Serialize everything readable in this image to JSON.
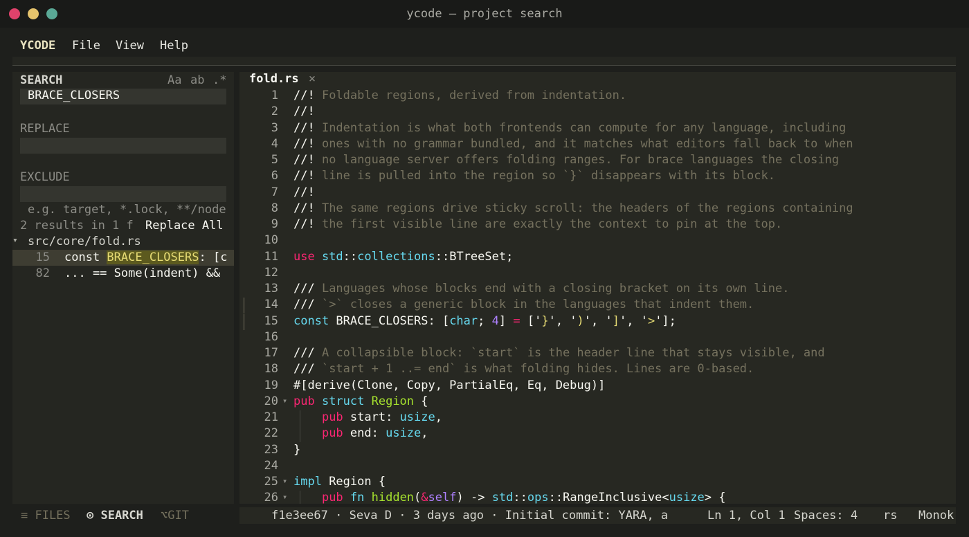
{
  "window": {
    "title": "ycode — project search",
    "traffic_lights": [
      "#e0426b",
      "#e5c36c",
      "#5aa996"
    ]
  },
  "menu": {
    "brand": "YCODE",
    "items": [
      "File",
      "View",
      "Help"
    ]
  },
  "sidebar": {
    "search_label": "SEARCH",
    "options": [
      "Aa",
      "ab",
      ".*"
    ],
    "search_value": "BRACE_CLOSERS",
    "replace_label": "REPLACE",
    "replace_value": "",
    "exclude_label": "EXCLUDE",
    "exclude_value": "",
    "exclude_placeholder": "e.g. target, *.lock, **/node",
    "results_summary": "2 results in 1 f",
    "replace_all_label": "Replace All",
    "file": {
      "chevron": "▾",
      "path": "src/core/fold.rs"
    },
    "results": [
      {
        "line": "15",
        "before": "const ",
        "match": "BRACE_CLOSERS",
        "after": ": [c"
      },
      {
        "line": "82",
        "before": "... == Some(indent) &&",
        "match": "",
        "after": ""
      }
    ]
  },
  "editor": {
    "tab_label": "fold.rs",
    "tab_close": "×",
    "lines": [
      {
        "n": "1",
        "tokens": [
          [
            "plain",
            "//! "
          ],
          [
            "comment",
            "Foldable regions, derived from indentation."
          ]
        ]
      },
      {
        "n": "2",
        "tokens": [
          [
            "plain",
            "//!"
          ]
        ]
      },
      {
        "n": "3",
        "tokens": [
          [
            "plain",
            "//! "
          ],
          [
            "comment",
            "Indentation is what both frontends can compute for any language, including"
          ]
        ]
      },
      {
        "n": "4",
        "tokens": [
          [
            "plain",
            "//! "
          ],
          [
            "comment",
            "ones with no grammar bundled, and it matches what editors fall back to when"
          ]
        ]
      },
      {
        "n": "5",
        "tokens": [
          [
            "plain",
            "//! "
          ],
          [
            "comment",
            "no language server offers folding ranges. For brace languages the closing"
          ]
        ]
      },
      {
        "n": "6",
        "tokens": [
          [
            "plain",
            "//! "
          ],
          [
            "comment",
            "line is pulled into the region so `}` disappears with its block."
          ]
        ]
      },
      {
        "n": "7",
        "tokens": [
          [
            "plain",
            "//!"
          ]
        ]
      },
      {
        "n": "8",
        "tokens": [
          [
            "plain",
            "//! "
          ],
          [
            "comment",
            "The same regions drive sticky scroll: the headers of the regions containing"
          ]
        ]
      },
      {
        "n": "9",
        "tokens": [
          [
            "plain",
            "//! "
          ],
          [
            "comment",
            "the first visible line are exactly the context to pin at the top."
          ]
        ]
      },
      {
        "n": "10",
        "tokens": []
      },
      {
        "n": "11",
        "tokens": [
          [
            "kw",
            "use "
          ],
          [
            "type",
            "std"
          ],
          [
            "plain",
            "::"
          ],
          [
            "type",
            "collections"
          ],
          [
            "plain",
            "::BTreeSet;"
          ]
        ]
      },
      {
        "n": "12",
        "tokens": []
      },
      {
        "n": "13",
        "tokens": [
          [
            "plain",
            "/// "
          ],
          [
            "comment",
            "Languages whose blocks end with a closing bracket on its own line."
          ]
        ]
      },
      {
        "n": "14",
        "tokens": [
          [
            "plain",
            "/// "
          ],
          [
            "comment",
            "`>` closes a generic block in the languages that indent them."
          ]
        ]
      },
      {
        "n": "15",
        "tokens": [
          [
            "type",
            "const "
          ],
          [
            "plain",
            "BRACE_CLOSERS: ["
          ],
          [
            "type",
            "char"
          ],
          [
            "plain",
            "; "
          ],
          [
            "num",
            "4"
          ],
          [
            "plain",
            "] "
          ],
          [
            "kw",
            "="
          ],
          [
            "plain",
            " ['"
          ],
          [
            "str",
            "}"
          ],
          [
            "plain",
            "', '"
          ],
          [
            "str",
            ")"
          ],
          [
            "plain",
            "', '"
          ],
          [
            "str",
            "]"
          ],
          [
            "plain",
            "', '"
          ],
          [
            "str",
            ">"
          ],
          [
            "plain",
            "'];"
          ]
        ]
      },
      {
        "n": "16",
        "tokens": []
      },
      {
        "n": "17",
        "tokens": [
          [
            "plain",
            "/// "
          ],
          [
            "comment",
            "A collapsible block: `start` is the header line that stays visible, and"
          ]
        ]
      },
      {
        "n": "18",
        "tokens": [
          [
            "plain",
            "/// "
          ],
          [
            "comment",
            "`start + 1 ..= end` is what folding hides. Lines are 0-based."
          ]
        ]
      },
      {
        "n": "19",
        "tokens": [
          [
            "plain",
            "#[derive(Clone, Copy, PartialEq, Eq, Debug)]"
          ]
        ]
      },
      {
        "n": "20",
        "fold": "▾",
        "tokens": [
          [
            "kw",
            "pub "
          ],
          [
            "type",
            "struct "
          ],
          [
            "fn",
            "Region"
          ],
          [
            "plain",
            " {"
          ]
        ]
      },
      {
        "n": "21",
        "guide": true,
        "tokens": [
          [
            "plain",
            "    "
          ],
          [
            "kw",
            "pub "
          ],
          [
            "plain",
            "start: "
          ],
          [
            "type",
            "usize"
          ],
          [
            "plain",
            ","
          ]
        ]
      },
      {
        "n": "22",
        "guide": true,
        "tokens": [
          [
            "plain",
            "    "
          ],
          [
            "kw",
            "pub "
          ],
          [
            "plain",
            "end: "
          ],
          [
            "type",
            "usize"
          ],
          [
            "plain",
            ","
          ]
        ]
      },
      {
        "n": "23",
        "tokens": [
          [
            "plain",
            "}"
          ]
        ]
      },
      {
        "n": "24",
        "tokens": []
      },
      {
        "n": "25",
        "fold": "▾",
        "tokens": [
          [
            "type",
            "impl "
          ],
          [
            "plain",
            "Region {"
          ]
        ]
      },
      {
        "n": "26",
        "fold": "▾",
        "guide": true,
        "tokens": [
          [
            "plain",
            "    "
          ],
          [
            "kw",
            "pub "
          ],
          [
            "type",
            "fn "
          ],
          [
            "fn",
            "hidden"
          ],
          [
            "plain",
            "("
          ],
          [
            "kw",
            "&"
          ],
          [
            "num",
            "self"
          ],
          [
            "plain",
            ") -> "
          ],
          [
            "type",
            "std"
          ],
          [
            "plain",
            "::"
          ],
          [
            "type",
            "ops"
          ],
          [
            "plain",
            "::RangeInclusive<"
          ],
          [
            "type",
            "usize"
          ],
          [
            "plain",
            "> {"
          ]
        ]
      }
    ]
  },
  "statusbar": {
    "files_tab": "≡ FILES",
    "search_tab": "⊙ SEARCH",
    "git_tab": "⌥GIT",
    "blame": "f1e3ee67 · Seva D · 3 days ago · Initial commit: YARA, a",
    "position": "Ln 1, Col 1",
    "indent": "Spaces: 4",
    "language": "rs",
    "theme": "Monok"
  }
}
